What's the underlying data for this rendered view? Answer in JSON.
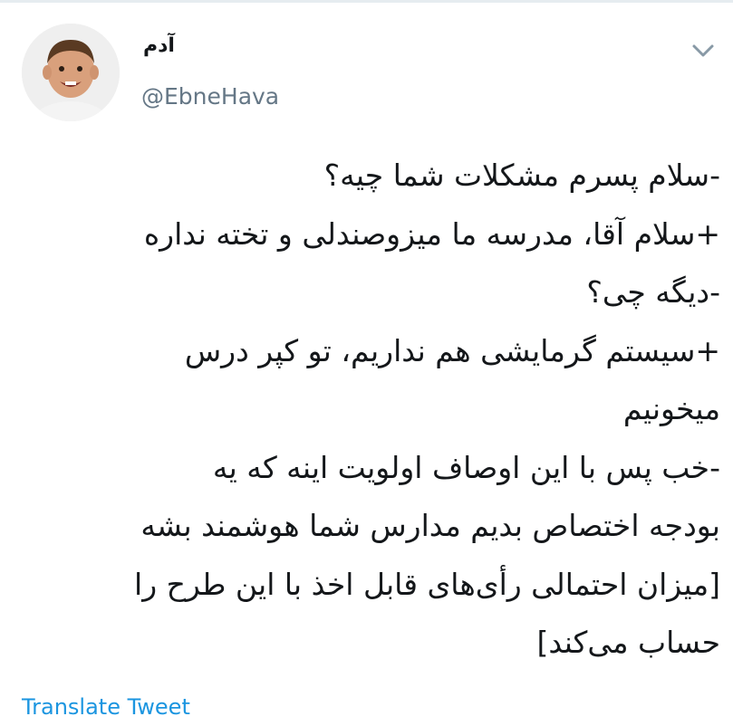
{
  "tweet": {
    "author": {
      "display_name": "آدم",
      "handle": "@EbneHava",
      "avatar_icon": "avatar-photo-smiling-child"
    },
    "menu_icon": "chevron-down-icon",
    "text_lines": [
      "-سلام پسرم مشکلات شما چیه؟",
      "+سلام آقا، مدرسه ما میزوصندلی و تخته نداره",
      "-دیگه چی؟",
      "+سیستم گرمایشی هم نداریم، تو کپر درس",
      "میخونیم",
      "-خب پس با این اوصاف اولویت اینه که یه",
      "بودجه اختصاص بدیم مدارس شما هوشمند بشه",
      "[میزان احتمالی رأی‌های قابل اخذ با این طرح را",
      "حساب می‌کند]"
    ],
    "translate_label": "Translate Tweet"
  },
  "colors": {
    "text": "#14171a",
    "secondary": "#657786",
    "link": "#1b95e0",
    "divider": "#e6ecf0"
  }
}
